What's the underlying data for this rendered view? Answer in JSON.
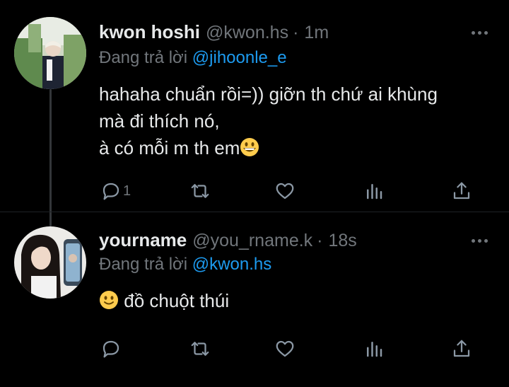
{
  "tweets": [
    {
      "name": "kwon hoshi",
      "handle": "@kwon.hs",
      "separator": "·",
      "time": "1m",
      "reply_prefix": "Đang trả lời",
      "reply_to": "@jihoonle_e",
      "lines": [
        "hahaha chuẩn rồi=)) giỡn th chứ ai khùng",
        "mà đi thích nó,",
        "à có mỗi m th em"
      ],
      "end_emoji": "grinning-face-emoji",
      "reply_count": "1"
    },
    {
      "name": "yourname",
      "handle": "@you_rname.k",
      "separator": "·",
      "time": "18s",
      "reply_prefix": "Đang trả lời",
      "reply_to": "@kwon.hs",
      "start_emoji": "slightly-smiling-face-emoji",
      "text": "đồ chuột thúi",
      "reply_count": ""
    }
  ],
  "icons": {
    "reply": "reply-icon",
    "retweet": "retweet-icon",
    "like": "heart-icon",
    "views": "views-icon",
    "share": "share-icon",
    "more": "more-icon"
  },
  "colors": {
    "background": "#000000",
    "text": "#e7e9ea",
    "muted": "#71767b",
    "accent": "#1d9bf0"
  }
}
